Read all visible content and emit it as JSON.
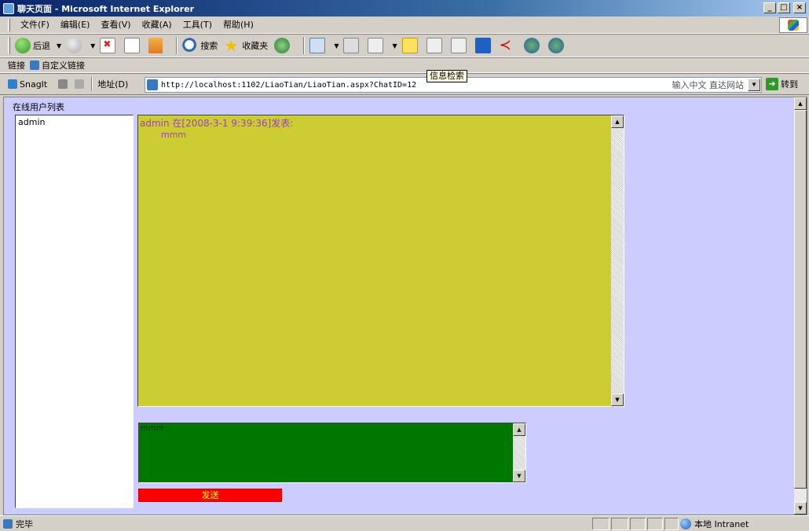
{
  "window": {
    "title": "聊天页面 - Microsoft Internet Explorer"
  },
  "menu": [
    "文件(F)",
    "编辑(E)",
    "查看(V)",
    "收藏(A)",
    "工具(T)",
    "帮助(H)"
  ],
  "toolbar": {
    "back": "后退",
    "search": "搜索",
    "favorites": "收藏夹",
    "tooltip": "信息检索"
  },
  "links": {
    "label": "链接",
    "custom": "自定义链接"
  },
  "addressbar": {
    "snagit": "SnagIt",
    "label": "地址(D)",
    "url": "http://localhost:1102/LiaoTian/LiaoTian.aspx?ChatID=12",
    "hint": "输入中文 直达网站",
    "go": "转到"
  },
  "chat": {
    "online_title": "在线用户列表",
    "users": [
      "admin"
    ],
    "messages": [
      {
        "header": "admin 在[2008-3-1 9:39:36]发表:",
        "body": "mmm"
      }
    ],
    "input_value": "mmm",
    "send": "发送"
  },
  "status": {
    "text": "完毕",
    "zone": "本地 Intranet"
  },
  "colors": {
    "page_bg": "#ccccff",
    "chat_log_bg": "#cccc33",
    "message_text": "#a040c0",
    "input_bg": "#007700",
    "send_bg": "#ff0000",
    "send_text": "#ffff00"
  }
}
